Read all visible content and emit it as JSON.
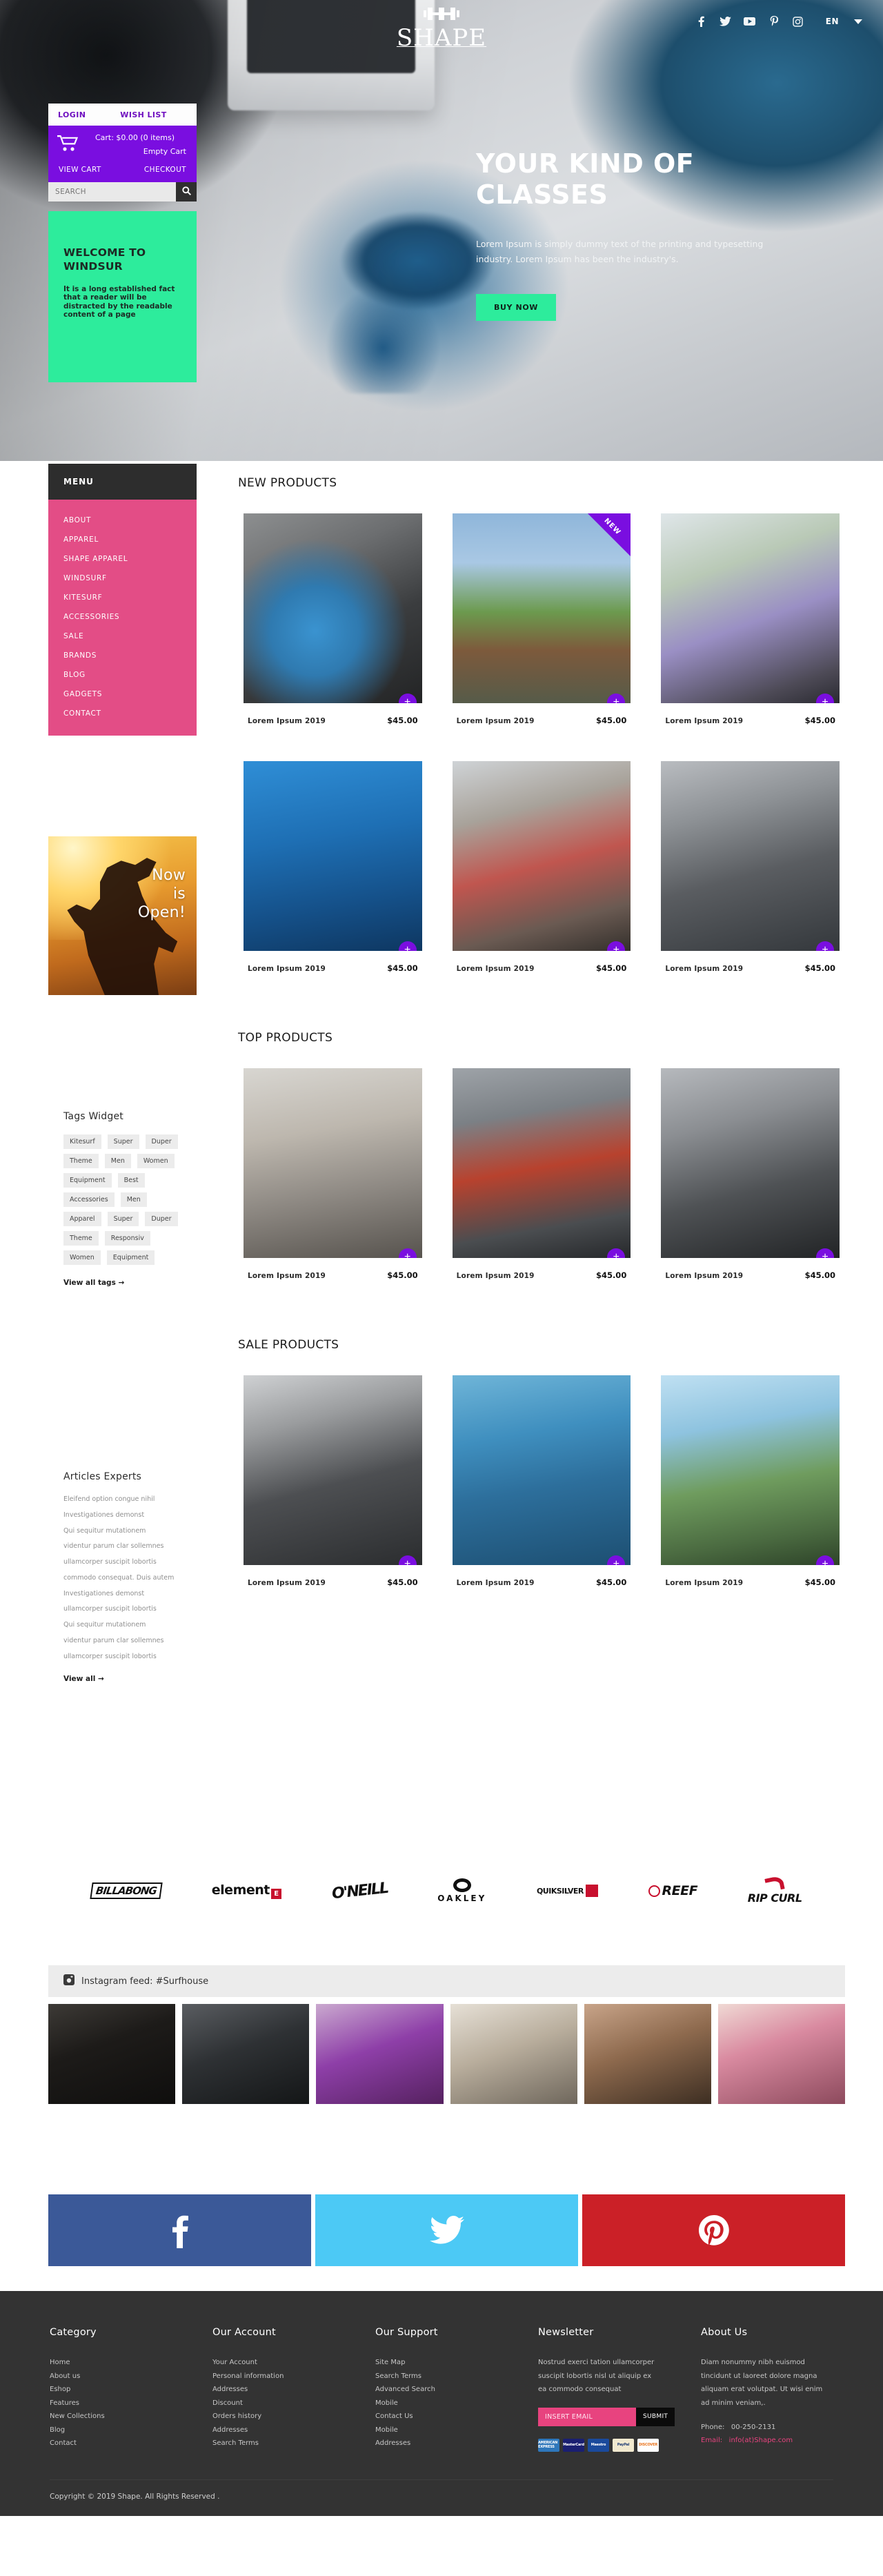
{
  "brand": {
    "name": "SHAPE",
    "logo_icon": "dumbbell-icon"
  },
  "topbar": {
    "social": [
      {
        "name": "facebook-icon",
        "label": "f"
      },
      {
        "name": "twitter-icon",
        "label": "t"
      },
      {
        "name": "youtube-icon",
        "label": "yt"
      },
      {
        "name": "pinterest-icon",
        "label": "p"
      },
      {
        "name": "instagram-icon",
        "label": "ig"
      }
    ],
    "language": "EN"
  },
  "account": {
    "login": "LOGIN",
    "wishlist": "WISH LIST"
  },
  "cart": {
    "icon": "shopping-cart-icon",
    "total_label": "Cart: $0.00 (0 items)",
    "empty_label": "Empty Cart",
    "view_cart": "VIEW CART",
    "checkout": "CHECKOUT"
  },
  "search": {
    "placeholder": "SEARCH",
    "value": "",
    "icon": "search-icon"
  },
  "welcome": {
    "title": "WELCOME TO WINDSUR",
    "body": "It is a long established fact that a reader will be distracted by the readable content of a page"
  },
  "hero": {
    "title": "YOUR KIND OF CLASSES",
    "body": "Lorem Ipsum is simply dummy text of the printing and typesetting industry. Lorem Ipsum has been the industry's.",
    "cta": "BUY NOW"
  },
  "menu": {
    "heading": "MENU",
    "items": [
      "ABOUT",
      "APPAREL",
      "SHAPE APPAREL",
      "WINDSURF",
      "KITESURF",
      "ACCESSORIES",
      "SALE",
      "BRANDS",
      "BLOG",
      "GADGETS",
      "CONTACT"
    ]
  },
  "promo": {
    "line1": "Now",
    "line2": "is",
    "line3": "Open!"
  },
  "tags_widget": {
    "title": "Tags Widget",
    "tags": [
      "Kitesurf",
      "Super",
      "Duper",
      "Theme",
      "Men",
      "Women",
      "Equipment",
      "Best",
      "Accessories",
      "Men",
      "Apparel",
      "Super",
      "Duper",
      "Theme",
      "Responsiv",
      "Women",
      "Equipment"
    ],
    "view_all": "View all tags →"
  },
  "articles_widget": {
    "title": "Articles Experts",
    "items": [
      "Eleifend option congue nihil",
      "Investigationes demonst",
      "Qui sequitur mutationem",
      "videntur parum clar sollemnes",
      "ullamcorper suscipit lobortis",
      "commodo consequat. Duis autem",
      "Investigationes demonst",
      "ullamcorper suscipit lobortis",
      "Qui sequitur mutationem",
      "videntur parum clar sollemnes",
      "ullamcorper suscipit lobortis"
    ],
    "view_all": "View all →"
  },
  "sections": [
    {
      "title": "NEW PRODUCTS",
      "products": [
        {
          "name": "Lorem Ipsum 2019",
          "price": "$45.00",
          "badge": "",
          "photo": "ph1"
        },
        {
          "name": "Lorem Ipsum 2019",
          "price": "$45.00",
          "badge": "NEW",
          "photo": "ph2"
        },
        {
          "name": "Lorem Ipsum 2019",
          "price": "$45.00",
          "badge": "",
          "photo": "ph3"
        },
        {
          "name": "Lorem Ipsum 2019",
          "price": "$45.00",
          "badge": "",
          "photo": "ph4"
        },
        {
          "name": "Lorem Ipsum 2019",
          "price": "$45.00",
          "badge": "",
          "photo": "ph5"
        },
        {
          "name": "Lorem Ipsum 2019",
          "price": "$45.00",
          "badge": "",
          "photo": "ph6"
        }
      ]
    },
    {
      "title": "TOP PRODUCTS",
      "products": [
        {
          "name": "Lorem Ipsum 2019",
          "price": "$45.00",
          "badge": "",
          "photo": "ph7"
        },
        {
          "name": "Lorem Ipsum 2019",
          "price": "$45.00",
          "badge": "",
          "photo": "ph8"
        },
        {
          "name": "Lorem Ipsum 2019",
          "price": "$45.00",
          "badge": "",
          "photo": "ph9"
        }
      ]
    },
    {
      "title": "SALE PRODUCTS",
      "products": [
        {
          "name": "Lorem Ipsum 2019",
          "price": "$45.00",
          "badge": "",
          "photo": "ph10"
        },
        {
          "name": "Lorem Ipsum 2019",
          "price": "$45.00",
          "badge": "",
          "photo": "ph11"
        },
        {
          "name": "Lorem Ipsum 2019",
          "price": "$45.00",
          "badge": "",
          "photo": "ph12"
        }
      ]
    }
  ],
  "add_to_cart_symbol": "+",
  "brands": [
    {
      "name": "billabong-logo",
      "label": "BILLABONG"
    },
    {
      "name": "element-logo",
      "label": "element"
    },
    {
      "name": "oneill-logo",
      "label": "O'NEILL"
    },
    {
      "name": "oakley-logo",
      "label": "OAKLEY"
    },
    {
      "name": "quiksilver-logo",
      "label": "QUIKSILVER"
    },
    {
      "name": "reef-logo",
      "label": "REEF"
    },
    {
      "name": "ripcurl-logo",
      "label": "RIP CURL"
    }
  ],
  "instagram": {
    "icon": "instagram-icon",
    "title": "Instagram feed: #Surfhouse"
  },
  "social_strip": [
    {
      "name": "facebook-banner",
      "color": "#3b5998"
    },
    {
      "name": "twitter-banner",
      "color": "#4cc9f5"
    },
    {
      "name": "pinterest-banner",
      "color": "#cb2027"
    }
  ],
  "footer": {
    "category": {
      "title": "Category",
      "links": [
        "Home",
        "About us",
        "Eshop",
        "Features",
        "New Collections",
        "Blog",
        "Contact"
      ]
    },
    "account": {
      "title": "Our Account",
      "links": [
        "Your Account",
        "Personal information",
        "Addresses",
        "Discount",
        "Orders history",
        "Addresses",
        "Search Terms"
      ]
    },
    "support": {
      "title": "Our Support",
      "links": [
        "Site Map",
        "Search Terms",
        "Advanced Search",
        "Mobile",
        "Contact Us",
        "Mobile",
        "Addresses"
      ]
    },
    "newsletter": {
      "title": "Newsletter",
      "text": "Nostrud exerci tation ullamcorper suscipit lobortis nisl ut aliquip ex ea commodo consequat",
      "input_placeholder": "INSERT EMAIL",
      "input_value": "",
      "submit": "SUBMIT",
      "payments": [
        "AMERICAN EXPRESS",
        "MasterCard",
        "Maestro",
        "PayPal",
        "DISCOVER"
      ]
    },
    "about": {
      "title": "About Us",
      "text": "Diam nonummy nibh euismod tincidunt ut laoreet dolore magna aliquam erat volutpat. Ut wisi enim ad minim veniam,.",
      "phone_label": "Phone:",
      "phone_value": "00-250-2131",
      "email_label": "Email:",
      "email_value": "info(at)Shape.com"
    },
    "copyright": "Copyright © 2019 Shape. All Rights Reserved ."
  },
  "colors": {
    "purple": "#7a0ee0",
    "pink": "#e34d86",
    "green": "#2dec9c",
    "dark": "#333333"
  }
}
